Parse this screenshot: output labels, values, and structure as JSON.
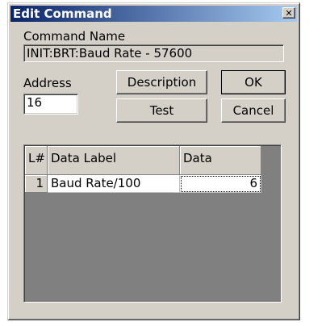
{
  "window": {
    "title": "Edit Command",
    "close_glyph": "✕"
  },
  "command_name": {
    "label": "Command Name",
    "value": "INIT:BRT:Baud Rate - 57600"
  },
  "address": {
    "label": "Address",
    "value": "16"
  },
  "buttons": {
    "description": "Description",
    "ok": "OK",
    "test": "Test",
    "cancel": "Cancel"
  },
  "grid": {
    "columns": [
      "L#",
      "Data Label",
      "Data"
    ],
    "rows": [
      {
        "line": "1",
        "label": "Baud Rate/100",
        "data": "6"
      }
    ]
  },
  "colors": {
    "title_start": "#0a246a",
    "title_end": "#a6caf0",
    "face": "#d4d0c8",
    "grid_background": "#808080"
  }
}
